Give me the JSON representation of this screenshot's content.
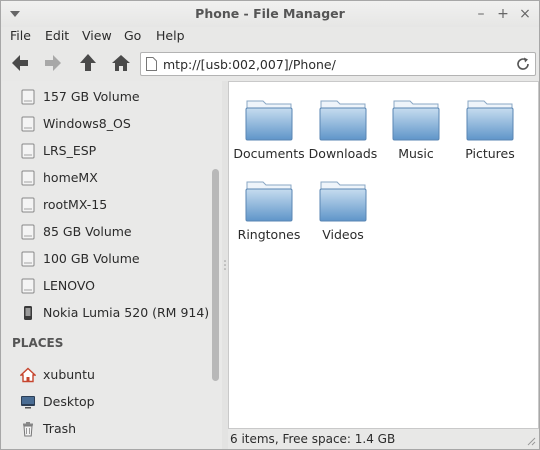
{
  "window": {
    "title": "Phone - File Manager",
    "controls": [
      "–",
      "+",
      "×"
    ]
  },
  "menubar": {
    "items": [
      "File",
      "Edit",
      "View",
      "Go",
      "Help"
    ]
  },
  "toolbar": {
    "icons": [
      "back-arrow-icon",
      "forward-arrow-icon",
      "parent-folder-icon",
      "home-icon"
    ],
    "location": "mtp://[usb:002,007]/Phone/"
  },
  "sidebar": {
    "devices": [
      {
        "label": "157 GB Volume",
        "icon": "drive-icon"
      },
      {
        "label": "Windows8_OS",
        "icon": "drive-icon"
      },
      {
        "label": "LRS_ESP",
        "icon": "drive-icon"
      },
      {
        "label": "homeMX",
        "icon": "drive-icon"
      },
      {
        "label": "rootMX-15",
        "icon": "drive-icon"
      },
      {
        "label": "85 GB Volume",
        "icon": "drive-icon"
      },
      {
        "label": "100 GB Volume",
        "icon": "drive-icon"
      },
      {
        "label": "LENOVO",
        "icon": "drive-icon"
      },
      {
        "label": "Nokia Lumia 520 (RM 914)",
        "icon": "phone-icon"
      }
    ],
    "places_header": "PLACES",
    "places": [
      {
        "label": "xubuntu",
        "icon": "home-icon"
      },
      {
        "label": "Desktop",
        "icon": "desktop-icon"
      },
      {
        "label": "Trash",
        "icon": "trash-icon"
      }
    ]
  },
  "files": [
    {
      "name": "Documents"
    },
    {
      "name": "Downloads"
    },
    {
      "name": "Music"
    },
    {
      "name": "Pictures"
    },
    {
      "name": "Ringtones"
    },
    {
      "name": "Videos"
    }
  ],
  "statusbar": {
    "text": "6 items, Free space: 1.4 GB"
  },
  "colors": {
    "folder_top": "#b9d3ea",
    "folder_bottom": "#5f95c9",
    "home_red": "#c6452e"
  }
}
